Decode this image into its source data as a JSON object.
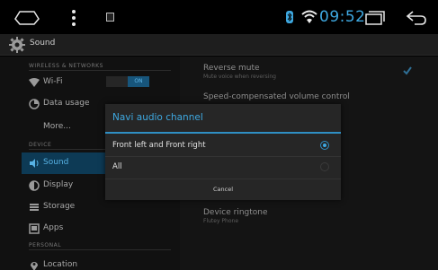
{
  "status_bar": {
    "time": "09:52",
    "icons": [
      "home-icon",
      "menu-icon",
      "gallery-icon",
      "bluetooth-icon",
      "wifi-icon",
      "recent-apps-icon",
      "back-icon"
    ],
    "accent_color": "#3ea8e0"
  },
  "action_bar": {
    "title": "Sound",
    "icon": "settings-gear-icon"
  },
  "sidebar": {
    "sections": [
      {
        "label": "WIRELESS & NETWORKS"
      },
      {
        "label": "DEVICE"
      },
      {
        "label": "PERSONAL"
      }
    ],
    "items": [
      {
        "label": "Wi-Fi",
        "icon": "wifi-icon",
        "toggle": "ON"
      },
      {
        "label": "Data usage",
        "icon": "data-usage-icon"
      },
      {
        "label": "More..."
      },
      {
        "label": "Sound",
        "icon": "speaker-icon",
        "active": true
      },
      {
        "label": "Display",
        "icon": "display-icon"
      },
      {
        "label": "Storage",
        "icon": "storage-icon"
      },
      {
        "label": "Apps",
        "icon": "apps-icon"
      },
      {
        "label": "Location",
        "icon": "location-icon"
      }
    ]
  },
  "preferences": [
    {
      "title": "Reverse mute",
      "summary": "Mute voice when reversing",
      "checked": true
    },
    {
      "title": "Speed-compensated volume control",
      "summary": ""
    },
    {
      "title": "Device ringtone",
      "summary": "Flutey Phone"
    }
  ],
  "dialog": {
    "title": "Navi audio channel",
    "options": [
      {
        "label": "Front left and Front right",
        "selected": true
      },
      {
        "label": "All",
        "selected": false
      }
    ],
    "cancel_label": "Cancel"
  }
}
